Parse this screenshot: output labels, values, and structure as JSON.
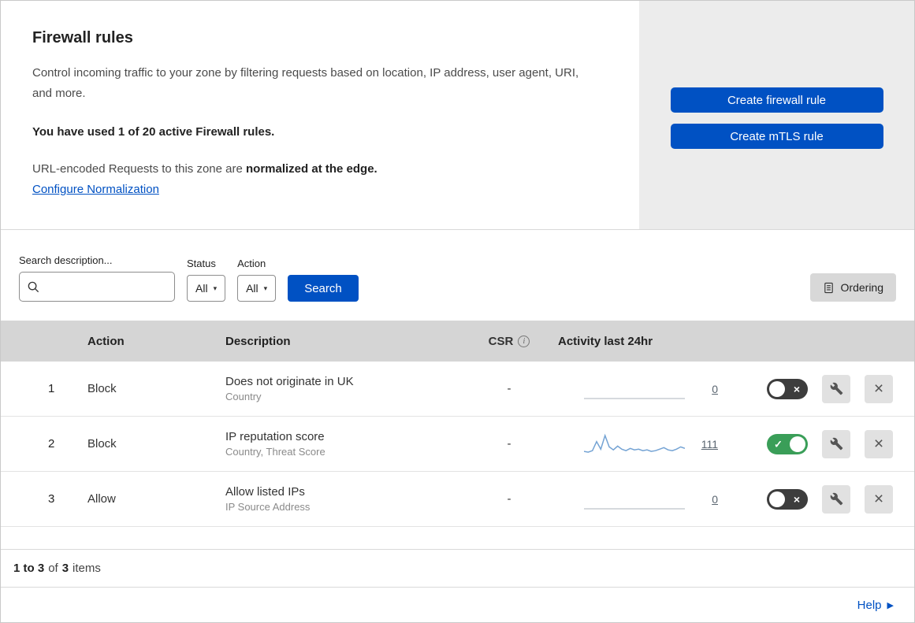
{
  "header": {
    "title": "Firewall rules",
    "description": "Control incoming traffic to your zone by filtering requests based on location, IP address, user agent, URI, and more.",
    "usage": "You have used 1 of 20 active Firewall rules.",
    "normalization_prefix": "URL-encoded Requests to this zone are ",
    "normalization_bold": "normalized at the edge.",
    "normalization_link": "Configure Normalization",
    "create_firewall_label": "Create firewall rule",
    "create_mtls_label": "Create mTLS rule"
  },
  "filters": {
    "search_label": "Search description...",
    "status_label": "Status",
    "status_value": "All",
    "action_label": "Action",
    "action_value": "All",
    "search_button_label": "Search",
    "ordering_button_label": "Ordering"
  },
  "table": {
    "headers": {
      "action": "Action",
      "description": "Description",
      "csr": "CSR",
      "activity": "Activity last 24hr"
    },
    "rows": [
      {
        "priority": "1",
        "action": "Block",
        "description": "Does not originate in UK",
        "fields": "Country",
        "csr": "-",
        "activity_count": "0",
        "enabled": false,
        "sparkline": [
          0,
          0,
          0,
          0,
          0,
          0,
          0,
          0,
          0,
          0,
          0,
          0,
          0,
          0,
          0,
          0,
          0,
          0,
          0,
          0
        ]
      },
      {
        "priority": "2",
        "action": "Block",
        "description": "IP reputation score",
        "fields": "Country, Threat Score",
        "csr": "-",
        "activity_count": "111",
        "enabled": true,
        "sparkline": [
          3,
          2,
          4,
          16,
          6,
          24,
          9,
          5,
          10,
          6,
          4,
          7,
          5,
          6,
          4,
          5,
          3,
          4,
          6,
          8,
          5,
          4,
          6,
          9,
          7
        ]
      },
      {
        "priority": "3",
        "action": "Allow",
        "description": "Allow listed IPs",
        "fields": "IP Source Address",
        "csr": "-",
        "activity_count": "0",
        "enabled": false,
        "sparkline": [
          0,
          0,
          0,
          0,
          0,
          0,
          0,
          0,
          0,
          0,
          0,
          0,
          0,
          0,
          0,
          0,
          0,
          0,
          0,
          0
        ]
      }
    ]
  },
  "footer": {
    "range": "1 to 3",
    "of": "of",
    "total": "3",
    "items": "items",
    "help_label": "Help"
  },
  "icons": {
    "caret": "▾",
    "check": "✓",
    "close": "×",
    "info": "i",
    "help_arrow": "▶"
  }
}
